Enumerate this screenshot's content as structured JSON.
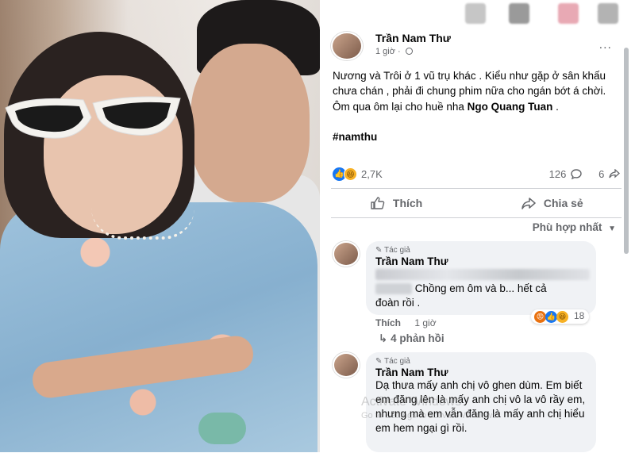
{
  "post": {
    "author": "Trần Nam Thư",
    "time": "1 giờ",
    "text_line1": "Nương và Trôi ở 1 vũ trụ khác . Kiểu như gặp ở sân khấu chưa chán , phải đi chung phim nữa cho ngán bớt á chời.",
    "text_line2_prefix": "Ôm qua ôm lại cho huề nha ",
    "mention": "Ngo Quang Tuan",
    "text_line2_suffix": " .",
    "hashtag": "#namthu",
    "more_icon": "...",
    "reaction_count": "2,7K",
    "comment_count": "126",
    "share_count": "6",
    "like_label": "Thích",
    "share_label": "Chia sẻ",
    "sort_label": "Phù hợp nhất"
  },
  "comments": [
    {
      "tag": "Tác giả",
      "author": "Trần Nam Thư",
      "blurred_text": "Chồng em ôm và b... hết cả",
      "text_end": "đoàn rồi .",
      "like_label": "Thích",
      "time": "1 giờ",
      "reaction_count": "18",
      "replies": "4 phản hồi"
    },
    {
      "tag": "Tác giả",
      "author": "Trần Nam Thư",
      "text": "Dạ thưa mấy anh chị vô ghen dùm. Em biết em đăng lên là mấy anh chị vô la vô rầy em, nhưng mà em vẫn đăng là mấy anh chị hiểu em hem ngại gì rồi."
    }
  ],
  "watermark": {
    "line1": "Activate Windows",
    "line2": "Go to Settings to activate Windows."
  },
  "colors": {
    "like_blue": "#1877f2",
    "haha_yellow": "#f7b125",
    "angry_orange": "#e9710f",
    "text_gray": "#65676b",
    "bubble_bg": "#f0f2f5"
  },
  "icons": {
    "like_reaction": "thumbs-up-icon",
    "haha_reaction": "haha-icon",
    "comment": "comment-icon",
    "share": "share-icon",
    "globe": "globe-icon",
    "pencil": "pencil-icon",
    "chevron_down": "chevron-down-icon",
    "reply_arrow": "reply-arrow-icon"
  }
}
